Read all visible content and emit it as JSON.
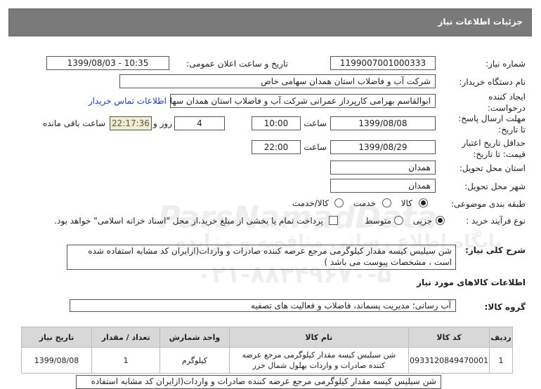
{
  "header": {
    "title": "جزئیات اطلاعات نیاز"
  },
  "fields": {
    "need_number_label": "شماره نیاز:",
    "need_number": "1199007001000333",
    "announce_label": "تاریخ و ساعت اعلان عمومی:",
    "announce_value": "1399/08/03 - 10:35",
    "buyer_label": "نام دستگاه خریدار:",
    "buyer_value": "شرکت آب و فاضلاب استان همدان سهامی خاص",
    "creator_label": "ایجاد کننده درخواست:",
    "creator_value": "ابوالقاسم بهرامی کارپرداز عمرانی شرکت آب و فاضلاب استان همدان سهامی خ",
    "contact_link": "اطلاعات تماس خریدار",
    "reply_deadline_label": "مهلت ارسال پاسخ: تا تاریخ:",
    "reply_date": "1399/08/08",
    "time_label": "ساعت",
    "reply_time": "10:00",
    "days_count": "4",
    "days_label": "روز و",
    "remaining_time": "22:17:36",
    "remaining_label": "ساعت باقی مانده",
    "validity_label": "حداقل تاریخ اعتبار قیمت: تا تاریخ:",
    "validity_date": "1399/08/29",
    "validity_time_label": "ساعت",
    "validity_time": "22:00",
    "province_label": "استان محل تحویل:",
    "province_value": "همدان",
    "city_label": "شهر محل تحویل:",
    "city_value": "همدان",
    "category_label": "طبقه بندی موضوعی:",
    "category_options": [
      "کالا",
      "خدمت",
      "کالا/خدمت"
    ],
    "process_label": "نوع فرآیند خرید :",
    "process_options": [
      "جزیی",
      "متوسط"
    ],
    "payment_note": "پرداخت تمام یا بخشی از مبلغ خرید،از محل \"اسناد خزانه اسلامی\" خواهد بود."
  },
  "description": {
    "label": "شرح کلی نیاز:",
    "text": "شن سیلیس کیسه مقدار کیلوگرمی مرجع عرضه کننده صادرات و واردات(ازایران کد مشابه استفاده شده است ، مشخصات پیوست می باشد )"
  },
  "goods_section_title": "اطلاعات کالاهای مورد نیاز",
  "goods_group": {
    "label": "گروه کالا:",
    "value": "آب رسانی؛ مدیریت پسماند، فاضلاب و فعالیت های تصفیه"
  },
  "table": {
    "headers": [
      "ردیف",
      "کد کالا",
      "نام کالا",
      "واحد شمارش",
      "تعداد / مقدار",
      "تاریخ نیاز"
    ],
    "rows": [
      [
        "1",
        "0933120849470001",
        "شن سیلیس کیسه مقدار کیلوگرمی مرجع عرضه کننده صادرات و واردات بهلول شمال خزر",
        "کیلوگرم",
        "1",
        "1399/08/08"
      ]
    ]
  },
  "bottom_text": "شن سیلیس کیسه مقدار کیلوگرمی مرجع عرضه کننده صادرات و واردات(ازایران کد مشابه استفاده",
  "watermark": {
    "brand": "ParsNamadData",
    "tagline": "پایگاه اطلاع رسانی مناقصه و مزایده",
    "phone": "۰۲۱-۸۸۳۴۹۶۷۰-۵"
  }
}
